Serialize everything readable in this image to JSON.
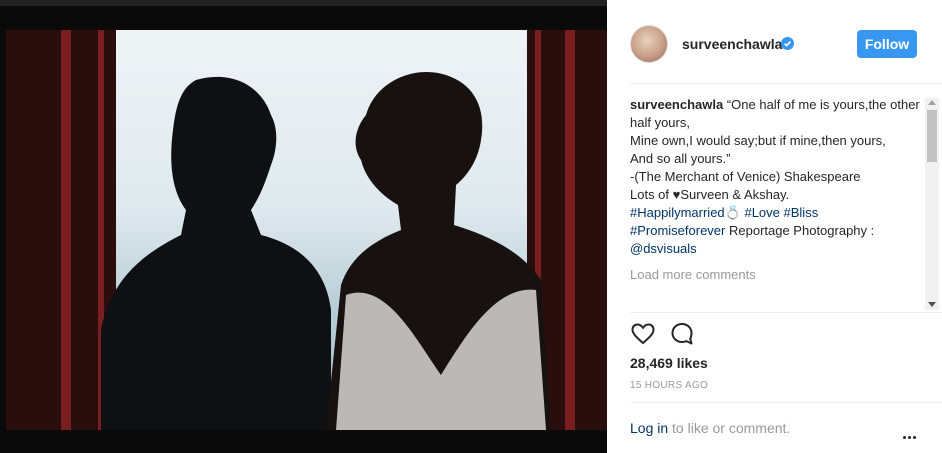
{
  "post": {
    "username": "surveenchawla",
    "follow_label": "Follow",
    "caption_user": "surveenchawla",
    "caption_lines": [
      " “One half of me is yours,the other half yours,",
      "Mine own,I would say;but if mine,then yours,",
      "And so all yours.”",
      "-(The Merchant of Venice) Shakespeare",
      "Lots of ",
      "Surveen & Akshay."
    ],
    "heart_glyph": "♥",
    "tags": {
      "happily": "#Happilymarried",
      "ring": "💍",
      "love": "#Love",
      "bliss": "#Bliss",
      "promise": "#Promiseforever"
    },
    "credit_text": " Reportage Photography :",
    "mention": "@dsvisuals",
    "load_more": "Load more comments",
    "likes": "28,469 likes",
    "time": "15 HOURS AGO",
    "login_link": "Log in",
    "login_rest": " to like or comment."
  },
  "colors": {
    "accent": "#3897f0",
    "link": "#003569",
    "muted": "#999999"
  },
  "icons": {
    "verified": "verified-badge-icon",
    "like": "heart-outline-icon",
    "comment": "comment-bubble-icon",
    "more": "more-options-icon"
  }
}
